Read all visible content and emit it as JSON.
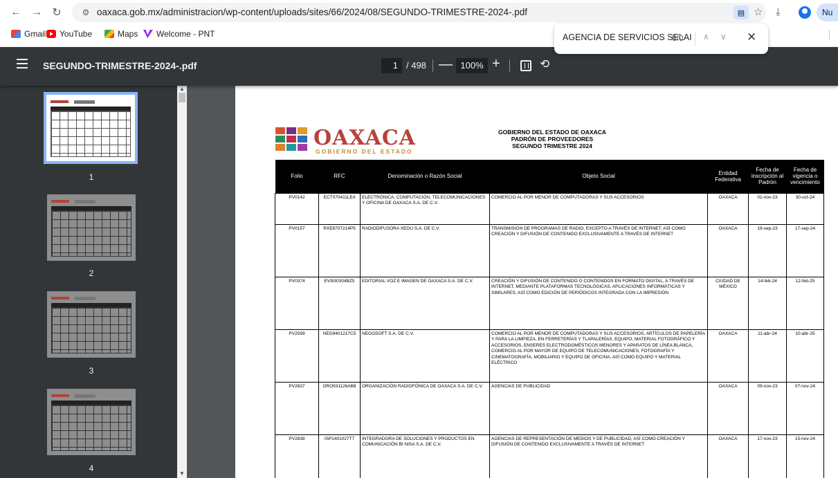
{
  "browser": {
    "url": "oaxaca.gob.mx/administracion/wp-content/uploads/sites/66/2024/08/SEGUNDO-TRIMESTRE-2024-.pdf",
    "update_label": "Nu",
    "bookmarks": [
      "Gmail",
      "YouTube",
      "Maps",
      "Welcome - PNT"
    ]
  },
  "find": {
    "query": "AGENCIA DE SERVICIOS SELAI",
    "count": "0/0"
  },
  "pdf": {
    "title": "SEGUNDO-TRIMESTRE-2024-.pdf",
    "page": "1",
    "total": "/ 498",
    "zoom": "100%"
  },
  "thumbnails": [
    "1",
    "2",
    "3",
    "4"
  ],
  "document": {
    "logo_text": "OAXACA",
    "logo_sub": "GOBIERNO DEL ESTADO",
    "heading": [
      "GOBIERNO DEL ESTADO DE OAXACA",
      "PADRÓN DE PROVEEDORES",
      "SEGUNDO TRIMESTRE 2024"
    ],
    "columns": [
      "Folio",
      "RFC",
      "Denominación o Razón Social",
      "Objeto Social",
      "Entidad Federativa",
      "Fecha de inscripción al Padrón",
      "Fecha de vigencia o vencimiento"
    ],
    "rows": [
      {
        "folio": "PV0142",
        "rfc": "ECT070411LE4",
        "razon": "ELECTRÓNICA, COMPUTACIÓN, TELECOMUNICACIONES Y OFICINA DE OAXACA S.A. DE C.V.",
        "objeto": "COMERCIO AL POR MENOR DE COMPUTADORAS Y SUS ACCESORIOS",
        "entidad": "OAXACA",
        "inscripcion": "01-nov-23",
        "vigencia": "30-oct-24"
      },
      {
        "folio": "PV0157",
        "rfc": "RXE8707214P5",
        "razon": "RADIODIFUSORA XEOU S.A. DE C.V.",
        "objeto": "TRANSMISIÓN DE PROGRAMAS DE RADIO, EXCEPTO A TRAVÉS DE INTERNET, ASÍ COMO CREACIÓN Y DIFUSIÓN DE CONTENIDO EXCLUSIVAMENTE A TRAVÉS DE INTERNET",
        "entidad": "OAXACA",
        "inscripcion": "19-sep-23",
        "vigencia": "17-sep-24"
      },
      {
        "folio": "PV0374",
        "rfc": "EVI930304BZ5",
        "razon": "EDITORIAL VOZ E IMAGEN DE OAXACA S.A. DE C.V.",
        "objeto": "CREACIÓN Y DIFUSIÓN DE CONTENIDO O CONTENIDOS EN FORMATO DIGITAL, A TRAVÉS DE INTERNET, MEDIANTE PLATAFORMAS TECNOLÓGICAS, APLICACIONES INFORMÁTICAS Y SIMILARES, ASÍ COMO EDICIÓN DE PERIÓDICOS INTEGRADA CON LA IMPRESIÓN",
        "entidad": "CIUDAD DE MÉXICO",
        "inscripcion": "14-feb-24",
        "vigencia": "12-feb-25"
      },
      {
        "folio": "PV2599",
        "rfc": "NEG9401217C5",
        "razon": "NEGOSOFT S.A. DE C.V.",
        "objeto": "COMERCIO AL POR MENOR DE COMPUTADORAS Y SUS ACCESORIOS, ARTÍCULOS DE PAPELERÍA Y PARA LA LIMPIEZA, EN FERRETERÍAS Y TLAPALERÍAS, EQUIPO, MATERIAL FOTOGRÁFICO Y ACCESORIOS, ENSERES ELECTRODOMÉSTICOS MENORES Y APARATOS DE LÍNEA BLANCA, COMERCIO AL POR MAYOR DE EQUIPO DE TELECOMUNICACIONES, FOTOGRAFÍA Y CINEMATOGRAFÍA, MOBILIARIO Y EQUIPO DE OFICINA, ASÍ COMO EQUIPO Y MATERIAL ELÉCTRICO",
        "entidad": "OAXACA",
        "inscripcion": "11-abr-24",
        "vigencia": "10-abr-25"
      },
      {
        "folio": "PV2837",
        "rfc": "ORO931126AB8",
        "razon": "ORGANIZACIÓN RADIOFÓNICA DE OAXACA S.A. DE C.V.",
        "objeto": "AGENCIAS DE PUBLICIDAD",
        "entidad": "OAXACA",
        "inscripcion": "09-nov-23",
        "vigencia": "07-nov-24"
      },
      {
        "folio": "PV2838",
        "rfc": "ISP1401027T7",
        "razon": "INTEGRADORA DE SOLUCIONES Y PRODUCTOS EN COMUNICACIÓN BI NISA S.A. DE C.V.",
        "objeto": "AGENCIAS DE REPRESENTACIÓN DE MEDIOS Y DE PUBLICIDAD, ASÍ COMO CREACIÓN Y DIFUSIÓN DE CONTENIDO EXCLUSIVAMENTE A TRAVÉS DE INTERNET",
        "entidad": "OAXACA",
        "inscripcion": "17-nov-23",
        "vigencia": "15-nov-24"
      }
    ]
  }
}
